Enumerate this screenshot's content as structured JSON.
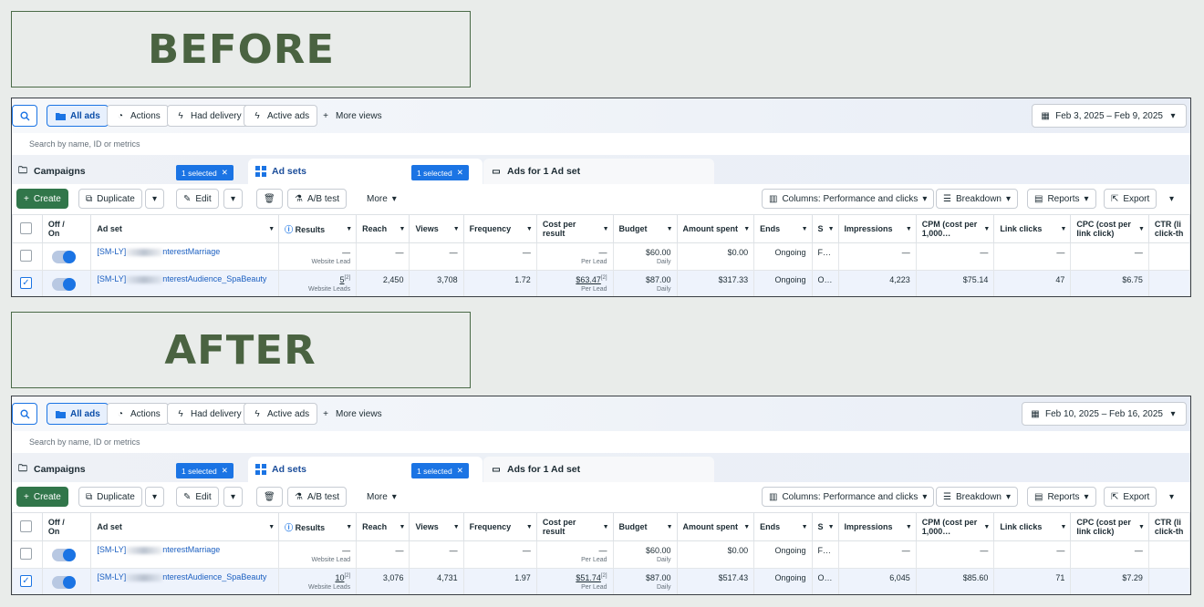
{
  "labels": {
    "before": "BEFORE",
    "after": "AFTER"
  },
  "icons": {
    "search": "search-icon",
    "folder": "folder-icon",
    "date": "calendar-icon"
  },
  "colors": {
    "accent": "#1b74e4",
    "create": "#31764a",
    "label_text": "#4a6341"
  },
  "common": {
    "tabs_pills": {
      "all_ads": "All ads",
      "actions": "Actions",
      "had_delivery": "Had delivery",
      "active_ads": "Active ads",
      "more_views": "More views"
    },
    "search_placeholder": "Search by name, ID or metrics",
    "tab_campaigns": "Campaigns",
    "tab_adsets": "Ad sets",
    "tab_ads": "Ads for 1 Ad set",
    "selected_chip": "1 selected",
    "toolbar": {
      "create": "Create",
      "duplicate": "Duplicate",
      "edit": "Edit",
      "ab_test": "A/B test",
      "more": "More",
      "columns": "Columns: Performance and clicks",
      "breakdown": "Breakdown",
      "reports": "Reports",
      "export": "Export"
    },
    "headers": {
      "offon1": "Off /",
      "offon2": "On",
      "adset": "Ad set",
      "results": "Results",
      "reach": "Reach",
      "views": "Views",
      "frequency": "Frequency",
      "cpr1": "Cost per",
      "cpr2": "result",
      "budget": "Budget",
      "amount_spent": "Amount spent",
      "ends": "Ends",
      "s": "S",
      "impressions": "Impressions",
      "cpm1": "CPM (cost per",
      "cpm2": "1,000…",
      "link_clicks": "Link clicks",
      "cpc1": "CPC (cost per",
      "cpc2": "link click)",
      "ctr1": "CTR (li",
      "ctr2": "click-th"
    },
    "units": {
      "website_lead": "Website Lead",
      "website_leads": "Website Leads",
      "per_lead": "Per Lead",
      "daily": "Daily"
    },
    "superscript": "[2]"
  },
  "before": {
    "date_range": "Feb 3, 2025 – Feb 9, 2025",
    "rows": [
      {
        "name_prefix": "[SM-LY]",
        "name_suffix": "nterestMarriage",
        "results": "—",
        "reach": "—",
        "views": "—",
        "frequency": "—",
        "cpr": "—",
        "budget": "$60.00",
        "spent": "$0.00",
        "ends": "Ongoing",
        "s": "F…",
        "impressions": "—",
        "cpm": "—",
        "link_clicks": "—",
        "cpc": "—",
        "checked": false
      },
      {
        "name_prefix": "[SM-LY]",
        "name_suffix": "nterestAudience_SpaBeauty",
        "results": "5",
        "reach": "2,450",
        "views": "3,708",
        "frequency": "1.72",
        "cpr": "$63.47",
        "budget": "$87.00",
        "spent": "$317.33",
        "ends": "Ongoing",
        "s": "O…",
        "impressions": "4,223",
        "cpm": "$75.14",
        "link_clicks": "47",
        "cpc": "$6.75",
        "checked": true
      }
    ]
  },
  "after": {
    "date_range": "Feb 10, 2025 – Feb 16, 2025",
    "rows": [
      {
        "name_prefix": "[SM-LY]",
        "name_suffix": "nterestMarriage",
        "results": "—",
        "reach": "—",
        "views": "—",
        "frequency": "—",
        "cpr": "—",
        "budget": "$60.00",
        "spent": "$0.00",
        "ends": "Ongoing",
        "s": "F…",
        "impressions": "—",
        "cpm": "—",
        "link_clicks": "—",
        "cpc": "—",
        "checked": false
      },
      {
        "name_prefix": "[SM-LY]",
        "name_suffix": "nterestAudience_SpaBeauty",
        "results": "10",
        "reach": "3,076",
        "views": "4,731",
        "frequency": "1.97",
        "cpr": "$51.74",
        "budget": "$87.00",
        "spent": "$517.43",
        "ends": "Ongoing",
        "s": "O…",
        "impressions": "6,045",
        "cpm": "$85.60",
        "link_clicks": "71",
        "cpc": "$7.29",
        "checked": true
      }
    ]
  }
}
